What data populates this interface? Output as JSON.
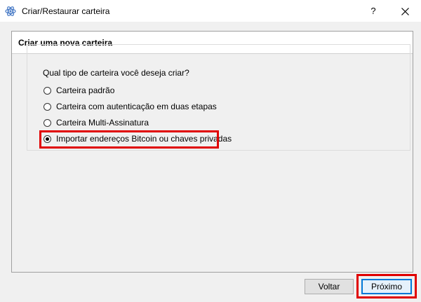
{
  "window": {
    "title": "Criar/Restaurar carteira",
    "help_label": "?",
    "close_icon": "close-icon",
    "app_icon": "electrum-logo-icon"
  },
  "page": {
    "title": "Criar uma nova carteira"
  },
  "wallet_type_group": {
    "title": "Qual tipo de carteira você deseja criar?",
    "options": [
      {
        "label": "Carteira padrão",
        "checked": false
      },
      {
        "label": "Carteira com autenticação em duas etapas",
        "checked": false
      },
      {
        "label": "Carteira Multi-Assinatura",
        "checked": false
      },
      {
        "label": "Importar endereços Bitcoin ou chaves privadas",
        "checked": true
      }
    ]
  },
  "footer": {
    "back_label": "Voltar",
    "next_label": "Próximo"
  },
  "colors": {
    "highlight": "#e00000",
    "default_button_border": "#0078d7"
  }
}
